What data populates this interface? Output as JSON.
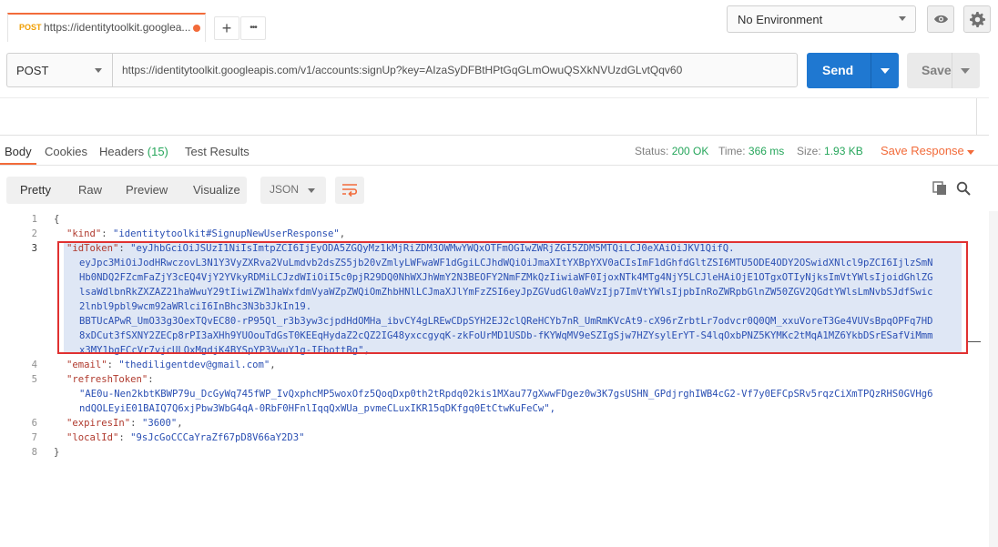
{
  "tab": {
    "method": "POST",
    "url": "https://identitytoolkit.googlea..."
  },
  "tab_actions": {
    "add_glyph": "+",
    "more_glyph": "•••"
  },
  "environment": {
    "selected": "No Environment",
    "eye_icon": "eye-icon",
    "settings_icon": "gear-icon"
  },
  "request": {
    "method": "POST",
    "url": "https://identitytoolkit.googleapis.com/v1/accounts:signUp?key=AIzaSyDFBtHPtGqGLmOwuQSXkNVUzdGLvtQqv60",
    "send_label": "Send",
    "save_label": "Save"
  },
  "response_tabs": {
    "body": "Body",
    "cookies": "Cookies",
    "headers_label": "Headers",
    "headers_count": "(15)",
    "test_results": "Test Results"
  },
  "status": {
    "status_label": "Status:",
    "status_value": "200 OK",
    "time_label": "Time:",
    "time_value": "366 ms",
    "size_label": "Size:",
    "size_value": "1.93 KB",
    "save_response": "Save Response"
  },
  "view": {
    "pretty": "Pretty",
    "raw": "Raw",
    "preview": "Preview",
    "visualize": "Visualize",
    "format": "JSON",
    "wrap_icon": "wrap-lines-icon",
    "copy_icon": "copy-icon",
    "search_icon": "search-icon"
  },
  "json": {
    "line_numbers": [
      "1",
      "2",
      "3",
      "4",
      "5",
      "6",
      "7",
      "8"
    ],
    "open_brace": "{",
    "close_brace": "}",
    "kind_key": "\"kind\"",
    "kind_value": "\"identitytoolkit#SignupNewUserResponse\"",
    "idtoken_key": "\"idToken\"",
    "idtoken_lines": [
      "\"eyJhbGciOiJSUzI1NiIsImtpZCI6IjEyODA5ZGQyMz1kMjRiZDM3OWMwYWQxOTFmOGIwZWRjZGI5ZDM5MTQiLCJ0eXAiOiJKV1QifQ.",
      "eyJpc3MiOiJodHRwczovL3N1Y3VyZXRva2VuLmdvb2dsZS5jb20vZmlyLWFwaWF1dGgiLCJhdWQiOiJmaXItYXBpYXV0aCIsImF1dGhfdGltZSI6MTU5ODE4ODY2OSwidXNlcl9pZCI6IjlzSmN",
      "Hb0NDQ2FZcmFaZjY3cEQ4VjY2YVkyRDMiLCJzdWIiOiI5c0pjR29DQ0NhWXJhWmY2N3BEOFY2NmFZMkQzIiwiaWF0IjoxNTk4MTg4NjY5LCJleHAiOjE1OTgxOTIyNjksImVtYWlsIjoidGhlZG",
      "lsaWdlbnRkZXZAZ21haWwuY29tIiwiZW1haWxfdmVyaWZpZWQiOmZhbHNlLCJmaXJlYmFzZSI6eyJpZGVudGl0aWVzIjp7ImVtYWlsIjpbInRoZWRpbGlnZW50ZGV2QGdtYWlsLmNvbSJdfSwic",
      "2lnbl9pbl9wcm92aWRlciI6InBhc3N3b3JkIn19.",
      "BBTUcAPwR_UmO33g3OexTQvEC80-rP95Ql_r3b3yw3cjpdHdOMHa_ibvCY4gLREwCDpSYH2EJ2clQReHCYb7nR_UmRmKVcAt9-cX96rZrbtLr7odvcr0Q0QM_xxuVoreT3Ge4VUVsBpqOPFq7HD",
      "8xDCut3fSXNY2ZECp8rPI3aXHh9YUOouTdGsT0KEEqHydaZ2cQZ2IG48yxccgyqK-zkFoUrMD1USDb-fKYWqMV9eSZIgSjw7HZYsylErYT-S4lqOxbPNZ5KYMKc2tMqA1MZ6YkbDSrESafViMmm",
      "x3MY1bgFCcVr7vjcULOxMgdjK4BYSpYP3VwuY1g-IFbottBg\","
    ],
    "email_key": "\"email\"",
    "email_value": "\"thediligentdev@gmail.com\"",
    "refresh_key": "\"refreshToken\"",
    "refresh_lines": [
      "\"AE0u-Nen2kbtKBWP79u_DcGyWq745fWP_IvQxphcMP5woxOfz5QoqDxp0th2tRpdq02kis1MXau77gXwwFDgez0w3K7gsUSHN_GPdjrghIWB4cG2-Vf7y0EFCpSRv5rqzCiXmTPQzRHS0GVHg6",
      "ndQOLEyiE01BAIQ7Q6xjPbw3WbG4qA-0RbF0HFnlIqqQxWUa_pvmeCLuxIKR15qDKfgq0EtCtwKuFeCw\","
    ],
    "expires_key": "\"expiresIn\"",
    "expires_value": "\"3600\"",
    "localid_key": "\"localId\"",
    "localid_value": "\"9sJcGoCCCaYraZf67pD8V66aY2D3\""
  }
}
